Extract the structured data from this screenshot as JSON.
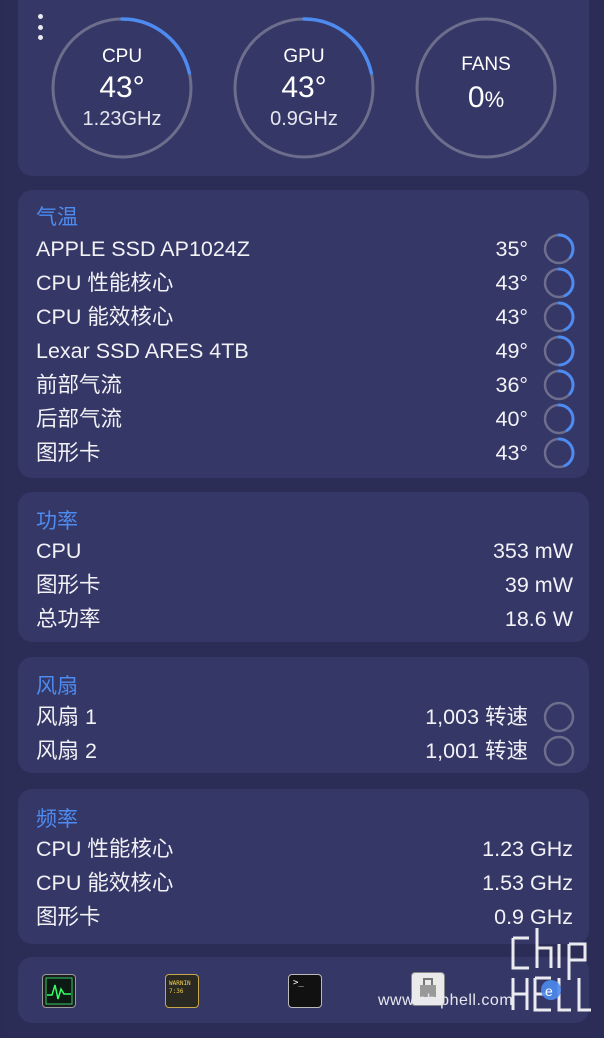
{
  "gauges": [
    {
      "id": "cpu",
      "label": "CPU",
      "value": "43°",
      "sub": "1.23GHz",
      "level": 0.43
    },
    {
      "id": "gpu",
      "label": "GPU",
      "value": "43°",
      "sub": "0.9GHz",
      "level": 0.43
    },
    {
      "id": "fans",
      "label": "FANS",
      "value": "0",
      "unit": "%",
      "level": 0.0
    }
  ],
  "temperature": {
    "title": "气温",
    "rows": [
      {
        "label": "APPLE SSD AP1024Z",
        "value": "35°",
        "level": 0.35
      },
      {
        "label": "CPU 性能核心",
        "value": "43°",
        "level": 0.43
      },
      {
        "label": "CPU 能效核心",
        "value": "43°",
        "level": 0.43
      },
      {
        "label": "Lexar SSD ARES 4TB",
        "value": "49°",
        "level": 0.49
      },
      {
        "label": "前部气流",
        "value": "36°",
        "level": 0.36
      },
      {
        "label": "后部气流",
        "value": "40°",
        "level": 0.4
      },
      {
        "label": "图形卡",
        "value": "43°",
        "level": 0.43
      }
    ]
  },
  "power": {
    "title": "功率",
    "rows": [
      {
        "label": "CPU",
        "value": "353 mW"
      },
      {
        "label": "图形卡",
        "value": "39 mW"
      },
      {
        "label": "总功率",
        "value": "18.6 W"
      }
    ]
  },
  "fans": {
    "title": "风扇",
    "rows": [
      {
        "label": "风扇 1",
        "value": "1,003 转速",
        "level": 0.0
      },
      {
        "label": "风扇 2",
        "value": "1,001 转速",
        "level": 0.0
      }
    ]
  },
  "frequency": {
    "title": "频率",
    "rows": [
      {
        "label": "CPU 性能核心",
        "value": "1.23 GHz"
      },
      {
        "label": "CPU 能效核心",
        "value": "1.53 GHz"
      },
      {
        "label": "图形卡",
        "value": "0.9 GHz"
      }
    ]
  },
  "dock": {
    "icons": [
      "activity-monitor-icon",
      "console-icon",
      "terminal-icon",
      "system-information-icon"
    ],
    "console_text": "WARNIN 7:36"
  },
  "watermark": {
    "text": "www.chiphell.com"
  },
  "colors": {
    "accent": "#4d8bf0",
    "track": "#6d6e8c",
    "card": "#353767",
    "background": "#2c2d57"
  }
}
